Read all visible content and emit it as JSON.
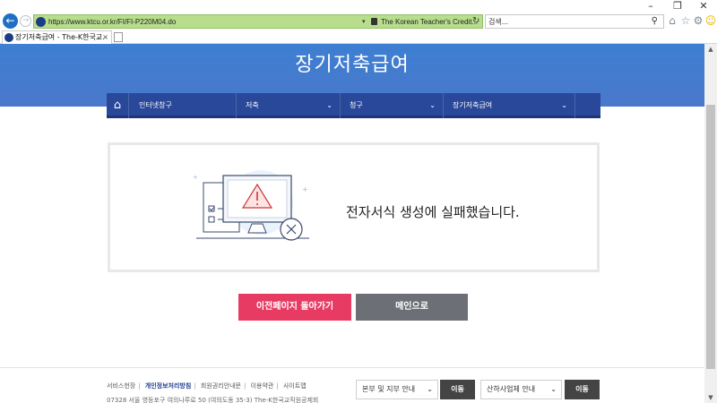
{
  "browser": {
    "url": "https://www.ktcu.or.kr/FI/FI-P220M04.do",
    "cert_label": "The Korean Teacher's Credit...",
    "search_placeholder": "검색...",
    "tab_title": "장기저축급여 - The-K한국교...",
    "tab_close": "×"
  },
  "page": {
    "hero_title": "장기저축급여",
    "nav": {
      "items": [
        {
          "label": "인터넷창구",
          "has_dropdown": false
        },
        {
          "label": "저축",
          "has_dropdown": true
        },
        {
          "label": "청구",
          "has_dropdown": true
        },
        {
          "label": "장기저축급여",
          "has_dropdown": true
        }
      ]
    },
    "error": {
      "message": "전자서식 생성에 실패했습니다."
    },
    "buttons": {
      "prev": "이전페이지 돌아가기",
      "main": "메인으로"
    }
  },
  "footer": {
    "links": [
      "서비스헌장",
      "개인정보처리방침",
      "회원권리안내문",
      "이용약관",
      "사이트맵"
    ],
    "address": "07328 서울 영등포구 여의나루로 50 (여의도동 35-3) The-K한국교직원공제회",
    "branch_select": "본부 및 지부 안내",
    "branch_go": "이동",
    "related_select": "산하사업체 안내",
    "related_go": "이동"
  },
  "colors": {
    "hero_blue": "#3d7fd2",
    "nav_blue": "#2a4899",
    "prev_button": "#e83b63",
    "main_button": "#6d6f76"
  },
  "icons": [
    "back-arrow-icon",
    "forward-arrow-icon",
    "lock-icon",
    "refresh-icon",
    "search-icon",
    "home-icon",
    "star-icon",
    "gear-icon",
    "smiley-icon",
    "warning-icon",
    "close-circle-icon"
  ]
}
